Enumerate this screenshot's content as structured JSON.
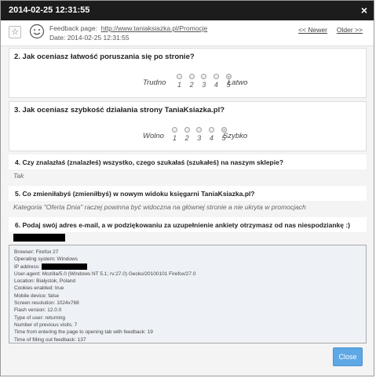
{
  "window": {
    "title": "2014-02-25 12:31:55",
    "close_symbol": "×"
  },
  "header": {
    "feedback_label": "Feedback page:",
    "feedback_url": "http://www.taniaksiazka.pl/Promocje",
    "date_label": "Date:",
    "date_value": "2014-02-25 12:31:55",
    "newer_link": "<< Newer",
    "older_link": "Older >>"
  },
  "questions": [
    {
      "title": "2. Jak oceniasz łatwość poruszania się po stronie?",
      "type": "rating",
      "left_label": "Trudno",
      "right_label": "Łatwo",
      "options": [
        "1",
        "2",
        "3",
        "4",
        "5"
      ],
      "selected": "5"
    },
    {
      "title": "3. Jak oceniasz szybkość działania strony TaniaKsiazka.pl?",
      "type": "rating",
      "left_label": "Wolno",
      "right_label": "Szybko",
      "options": [
        "1",
        "2",
        "3",
        "4",
        "5"
      ],
      "selected": "5"
    },
    {
      "title": "4. Czy znalazłaś (znalazłeś) wszystko, czego szukałaś (szukałeś) na naszym sklepie?",
      "answer": "Tak"
    },
    {
      "title": "5. Co zmieniłabyś (zmieniłbyś) w nowym widoku księgarni TaniaKsiazka.pl?",
      "answer": "Kategoria \"Oferta Dnia\" raczej powinna być widoczna na głównej stronie a nie ukryta w promocjach"
    },
    {
      "title": "6. Podaj swój adres e-mail, a w podziękowaniu za uzupełnienie ankiety otrzymasz od nas niespodziankę :)"
    }
  ],
  "info": {
    "browser": "Browser: Firefox 27",
    "os": "Operating system: Windows",
    "ip_label": "IP address:",
    "user_agent": "User-agent: Mozilla/5.0 (Windows NT 5.1; rv:27.0) Gecko/20100101 Firefox/27.0",
    "location": "Location: Białystok, Poland",
    "cookies": "Cookies enabled: true",
    "mobile": "Mobile device: false",
    "resolution": "Screen resolution: 1024x768",
    "flash": "Flash version: 12.0.0",
    "user_type": "Type of user: returning",
    "visits": "Number of previous visits: 7",
    "time_tab": "Time from entering the page to opening tab with feedback: 19",
    "time_fill": "Time of filling out feedback: 137"
  },
  "footer": {
    "close_label": "Close"
  },
  "colors": {
    "titlebar": "#1c1c1c",
    "close_button": "#5ea8e6",
    "info_bg": "#eef1f5"
  }
}
